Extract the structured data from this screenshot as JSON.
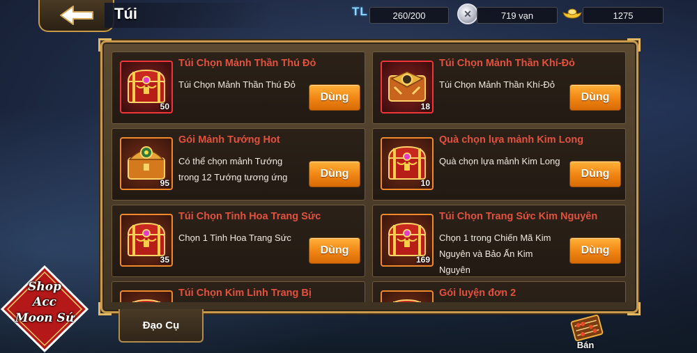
{
  "header": {
    "title": "Túi",
    "resources": [
      {
        "icon": "tl-icon",
        "label": "TL",
        "value": "260/200"
      },
      {
        "icon": "silver-coin-icon",
        "value": "719 vạn"
      },
      {
        "icon": "gold-ingot-icon",
        "value": "1275"
      }
    ]
  },
  "items": [
    {
      "name": "Túi Chọn Mảnh Thần Thú Đỏ",
      "desc": "Túi Chọn Mảnh Thần Thú Đỏ",
      "qty": "50",
      "frame": "red",
      "icon": "treasure-chest-icon",
      "button": "Dùng"
    },
    {
      "name": "Túi Chọn Mảnh Thần Khí-Đỏ",
      "desc": "Túi Chọn Mảnh Thần Khí-Đỏ",
      "qty": "18",
      "frame": "red",
      "icon": "golden-chest-icon",
      "button": "Dùng"
    },
    {
      "name": "Gói Mảnh Tướng Hot",
      "desc": "Có thể chọn mảnh Tướng trong 12 Tướng tương ứng",
      "qty": "95",
      "frame": "orange",
      "icon": "hero-chest-icon",
      "button": "Dùng"
    },
    {
      "name": "Quà chọn lựa mảnh Kim Long",
      "desc": "Quà chọn lựa mảnh Kim Long",
      "qty": "10",
      "frame": "orange",
      "icon": "treasure-chest-icon",
      "button": "Dùng"
    },
    {
      "name": "Túi Chọn Tinh Hoa Trang Sức",
      "desc": "Chọn 1 Tinh Hoa Trang Sức",
      "qty": "35",
      "frame": "orange",
      "icon": "treasure-chest-icon",
      "button": "Dùng"
    },
    {
      "name": "Túi Chọn Trang Sức Kim Nguyên",
      "desc": "Chọn 1 trong Chiến Mã Kim Nguyên và Bảo Ấn Kim Nguyên",
      "qty": "169",
      "frame": "orange",
      "icon": "treasure-chest-icon",
      "button": "Dùng"
    },
    {
      "name": "Túi Chọn Kim Linh Trang Bị",
      "desc": "",
      "qty": "",
      "frame": "orange",
      "icon": "treasure-chest-icon",
      "button": ""
    },
    {
      "name": "Gói luyện đơn 2",
      "desc": "",
      "qty": "",
      "frame": "orange",
      "icon": "treasure-chest-icon",
      "button": ""
    }
  ],
  "bottom": {
    "tab_label": "Đạo Cụ",
    "sell_label": "Bán"
  },
  "watermark": {
    "line1": "Shop",
    "line2": "Acc",
    "line3": "Moon Sứ"
  },
  "colors": {
    "item_name": "#e2523f",
    "button": "#f08412",
    "panel_border": "#c79a4e"
  }
}
